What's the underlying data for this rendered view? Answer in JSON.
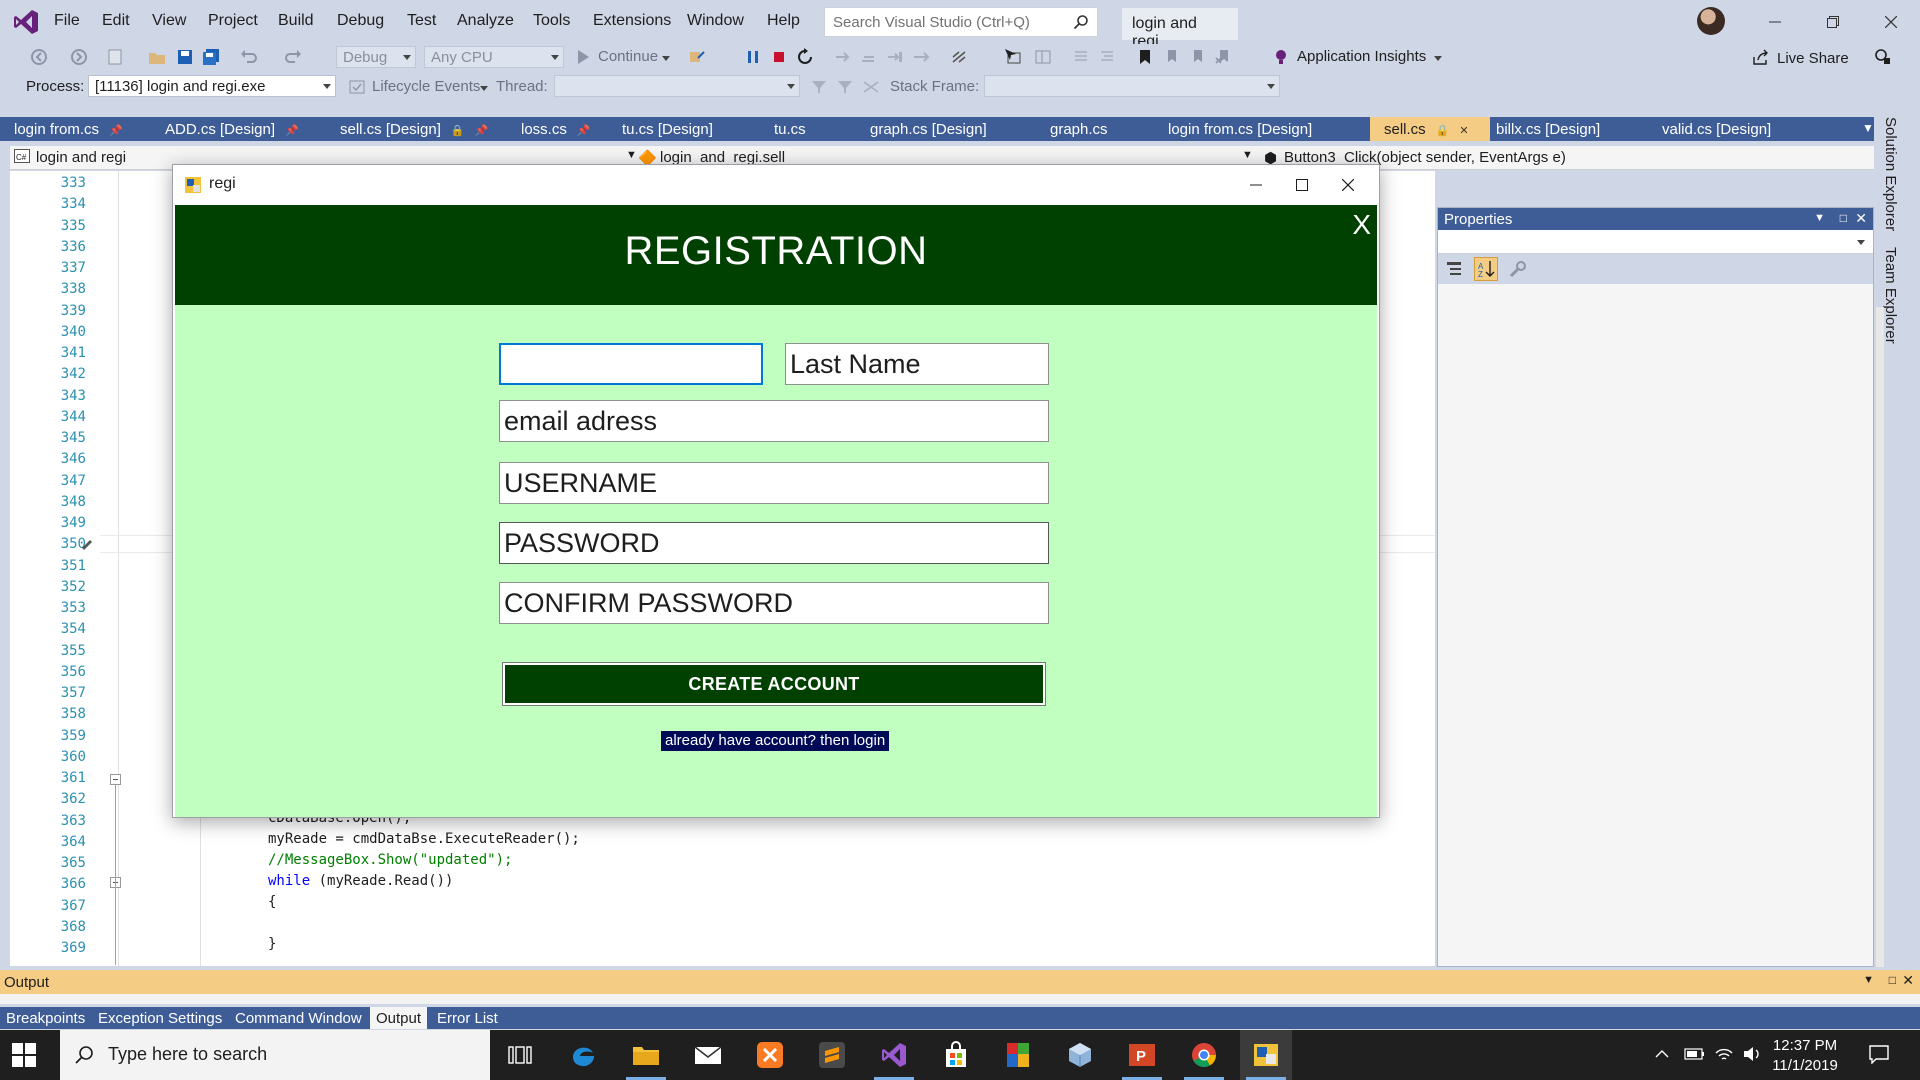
{
  "app": {
    "menu": [
      "File",
      "Edit",
      "View",
      "Project",
      "Build",
      "Debug",
      "Test",
      "Analyze",
      "Tools",
      "Extensions",
      "Window",
      "Help"
    ],
    "search_placeholder": "Search Visual Studio (Ctrl+Q)",
    "solution_name": "login and regi",
    "live_share_label": "Live Share"
  },
  "toolbar": {
    "config": "Debug",
    "platform": "Any CPU",
    "continue_label": "Continue",
    "app_insights_label": "Application Insights"
  },
  "debug_location": {
    "process_label": "Process:",
    "process_value": "[11136] login and regi.exe",
    "lifecycle_label": "Lifecycle Events",
    "thread_label": "Thread:",
    "stack_frame_label": "Stack Frame:"
  },
  "document_tabs": [
    {
      "label": "login from.cs",
      "pinned": true
    },
    {
      "label": "ADD.cs [Design]",
      "pinned": true
    },
    {
      "label": "sell.cs [Design]",
      "pinned": true
    },
    {
      "label": "loss.cs",
      "pinned": true
    },
    {
      "label": "tu.cs [Design]",
      "pinned": false
    },
    {
      "label": "tu.cs",
      "pinned": false
    },
    {
      "label": "graph.cs [Design]",
      "pinned": false
    },
    {
      "label": "graph.cs",
      "pinned": false
    },
    {
      "label": "login from.cs [Design]",
      "pinned": false
    },
    {
      "label": "sell.cs",
      "pinned": false,
      "active": true
    },
    {
      "label": "billx.cs [Design]",
      "pinned": false
    },
    {
      "label": "valid.cs [Design]",
      "pinned": false
    }
  ],
  "editor_nav": {
    "project": "login and regi",
    "class": "login_and_regi.sell",
    "member": "Button3_Click(object sender, EventArgs e)"
  },
  "editor": {
    "line_numbers": [
      "333",
      "334",
      "335",
      "336",
      "337",
      "338",
      "339",
      "340",
      "341",
      "342",
      "343",
      "344",
      "345",
      "346",
      "347",
      "348",
      "349",
      "350",
      "351",
      "352",
      "353",
      "354",
      "355",
      "356",
      "357",
      "358",
      "359",
      "360",
      "361",
      "362",
      "363",
      "364",
      "365",
      "366",
      "367",
      "368",
      "369"
    ],
    "visible_code": [
      {
        "line": "363",
        "text": "cDataBase.Open();"
      },
      {
        "line": "364",
        "text": "myReade = cmdDataBse.ExecuteReader();"
      },
      {
        "line": "365",
        "text": "//MessageBox.Show(\"updated\");"
      },
      {
        "line": "366",
        "kw": "while",
        "text": " (myReade.Read())"
      },
      {
        "line": "367",
        "text": "{"
      },
      {
        "line": "369",
        "text": "}"
      }
    ]
  },
  "properties_panel": {
    "title": "Properties"
  },
  "side_panels": [
    "Solution Explorer",
    "Team Explorer"
  ],
  "output_panel": {
    "title": "Output"
  },
  "bottom_tabs": [
    "Breakpoints",
    "Exception Settings",
    "Command Window",
    "Output",
    "Error List"
  ],
  "active_bottom_tab": "Output",
  "regi_window": {
    "title": "regi",
    "header": "REGISTRATION",
    "close_glyph": "X",
    "fields": {
      "first_name": "",
      "last_name": "Last Name",
      "email": "email adress",
      "username": "USERNAME",
      "password": "PASSWORD",
      "confirm_password": "CONFIRM PASSWORD"
    },
    "create_account_label": "CREATE ACCOUNT",
    "login_link_label": "already have account? then login",
    "colors": {
      "header_bg": "#004000",
      "body_bg": "#c0ffc0",
      "link_bg": "#000a56"
    }
  },
  "taskbar": {
    "search_placeholder": "Type here to search",
    "time": "12:37 PM",
    "date": "11/1/2019",
    "apps": [
      "task-view-icon",
      "edge-icon",
      "file-explorer-icon",
      "mail-icon",
      "xampp-icon",
      "sublime-icon",
      "visual-studio-icon",
      "store-icon",
      "winrar-icon",
      "cube-icon",
      "powerpoint-icon",
      "chrome-icon",
      "running-app-icon"
    ]
  },
  "theme": {
    "vs_chrome": "#cfd6e5",
    "vs_tab_bar": "#3e5d96",
    "vs_active_tab": "#f5cc84"
  }
}
